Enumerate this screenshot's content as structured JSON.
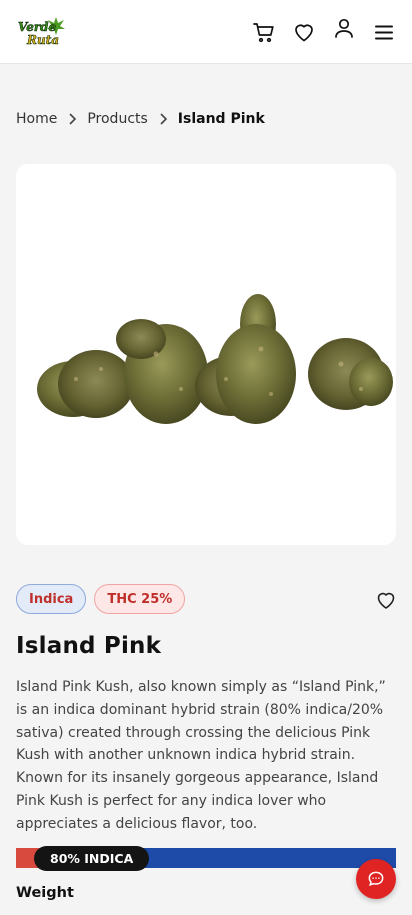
{
  "header": {
    "logo_text_top": "Verde",
    "logo_text_bottom": "Ruta",
    "icons": [
      "cart-icon",
      "heart-icon",
      "user-icon",
      "menu-icon"
    ]
  },
  "breadcrumb": [
    {
      "label": "Home"
    },
    {
      "label": "Products"
    },
    {
      "label": "Island Pink"
    }
  ],
  "product": {
    "image_icon": "cannabis-buds-image",
    "tags": [
      "Indica",
      "THC 25%"
    ],
    "name": "Island Pink",
    "description": "Island Pink Kush, also known simply as “Island Pink,” is an indica dominant hybrid strain (80% indica/20% sativa) created through crossing the delicious Pink Kush with another unknown indica hybrid strain. Known for its insanely gorgeous appearance, Island Pink Kush is perfect for any indica lover who appreciates a delicious flavor, too.",
    "strain_label": "80% INDICA",
    "indica_percent": 80,
    "weight_label": "Weight"
  },
  "colors": {
    "accent_red": "#e02424",
    "indica_blue": "#1f4ba8",
    "sativa_red": "#d94a3e",
    "logo_green": "#3a8a1e"
  }
}
